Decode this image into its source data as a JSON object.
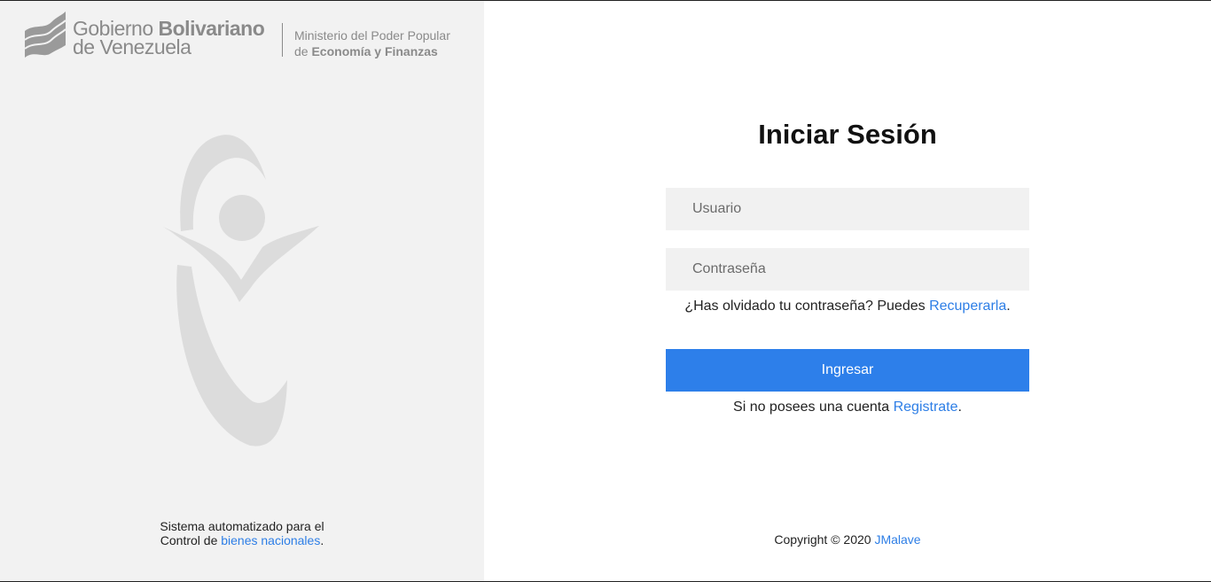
{
  "branding": {
    "gov_line1_a": "Gobierno ",
    "gov_line1_b": "Bolivariano",
    "gov_line2": "de Venezuela",
    "ministry_line1": "Ministerio del Poder Popular",
    "ministry_line2_a": "de ",
    "ministry_line2_b": "Economía y Finanzas"
  },
  "left_footer": {
    "line1": "Sistema automatizado para el",
    "line2_prefix": "Control de ",
    "link": "bienes nacionales",
    "suffix": "."
  },
  "login": {
    "title": "Iniciar Sesión",
    "username_placeholder": "Usuario",
    "password_placeholder": "Contraseña",
    "forgot_prefix": "¿Has olvidado tu contraseña? Puedes ",
    "forgot_link": "Recuperarla",
    "forgot_suffix": ".",
    "submit_label": "Ingresar",
    "register_prefix": "Si no posees una cuenta ",
    "register_link": "Registrate",
    "register_suffix": "."
  },
  "footer": {
    "copyright_prefix": "Copyright © 2020 ",
    "author_link": "JMalave"
  },
  "icons": [
    "venezuela-flag-icon",
    "person-emblem-icon"
  ],
  "colors": {
    "accent": "#2d7fea",
    "left_panel": "#f2f2f2",
    "input_bg": "#f1f1f1"
  }
}
